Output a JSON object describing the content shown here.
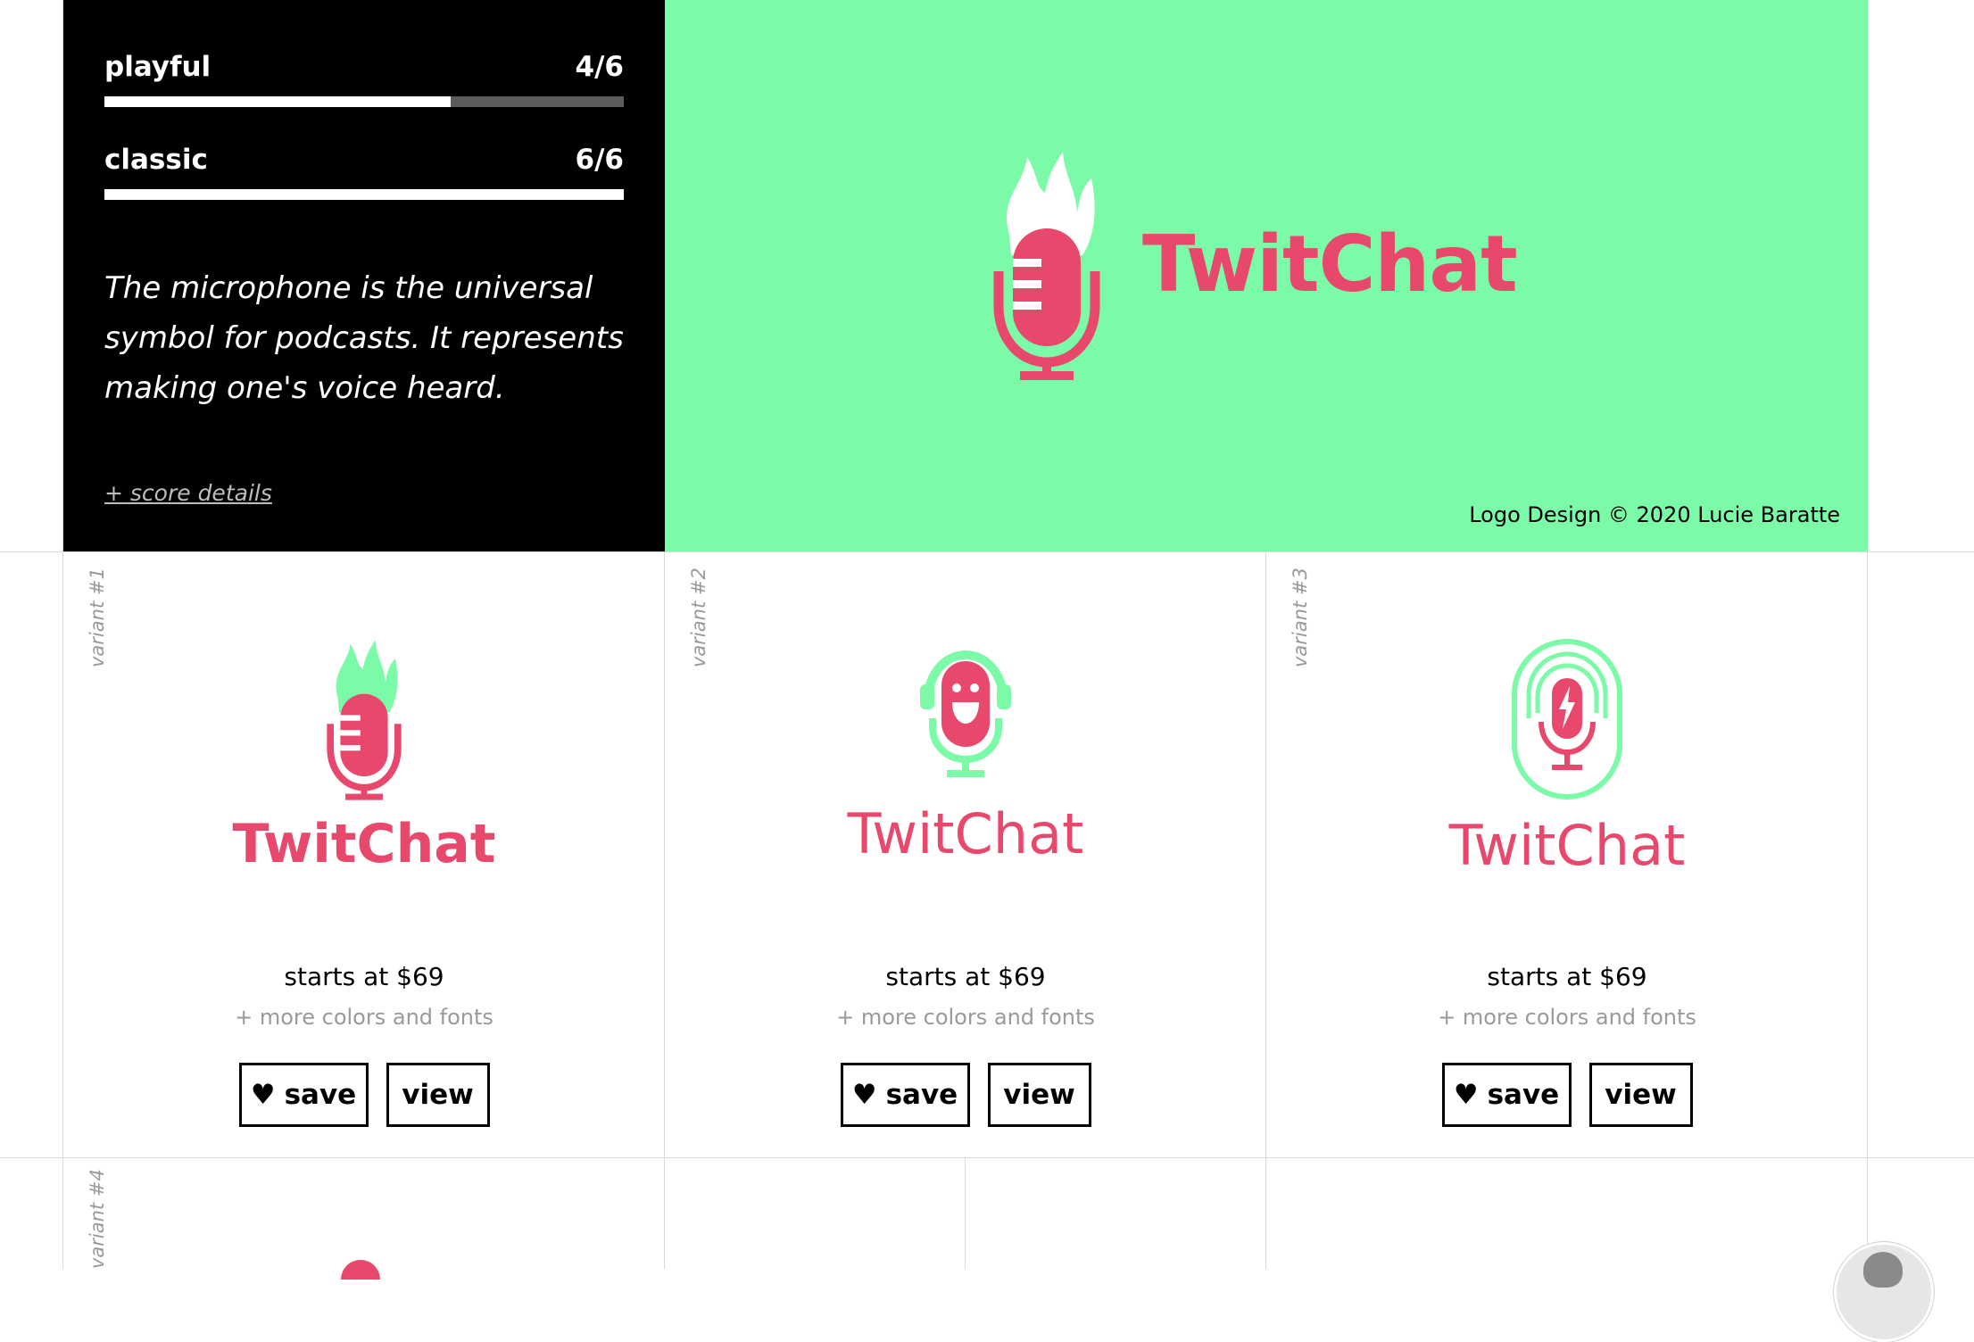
{
  "brand": "TwitChat",
  "colors": {
    "accent": "#e8486b",
    "mint": "#7bfaa8",
    "panel": "#000000"
  },
  "score": {
    "metrics": [
      {
        "label": "playful",
        "score": "4/6",
        "fraction": 0.667
      },
      {
        "label": "classic",
        "score": "6/6",
        "fraction": 1.0
      }
    ],
    "description": "The microphone is the universal symbol for podcasts. It represents making one's voice heard.",
    "details_link": "+ score details"
  },
  "hero": {
    "name": "TwitChat",
    "copyright": "Logo Design © 2020 Lucie Baratte",
    "icon": "flame-microphone-icon"
  },
  "variants": [
    {
      "label": "variant #1",
      "name": "TwitChat",
      "icon": "flame-microphone-icon",
      "price": "starts at $69",
      "more": "+ more colors and fonts",
      "save": "save",
      "view": "view"
    },
    {
      "label": "variant #2",
      "name": "TwitChat",
      "icon": "smiling-microphone-headphones-icon",
      "price": "starts at $69",
      "more": "+ more colors and fonts",
      "save": "save",
      "view": "view"
    },
    {
      "label": "variant #3",
      "name": "TwitChat",
      "icon": "lightning-microphone-waves-icon",
      "price": "starts at $69",
      "more": "+ more colors and fonts",
      "save": "save",
      "view": "view"
    }
  ],
  "next_row": {
    "label": "variant #4"
  },
  "save_icon": "heart-icon"
}
